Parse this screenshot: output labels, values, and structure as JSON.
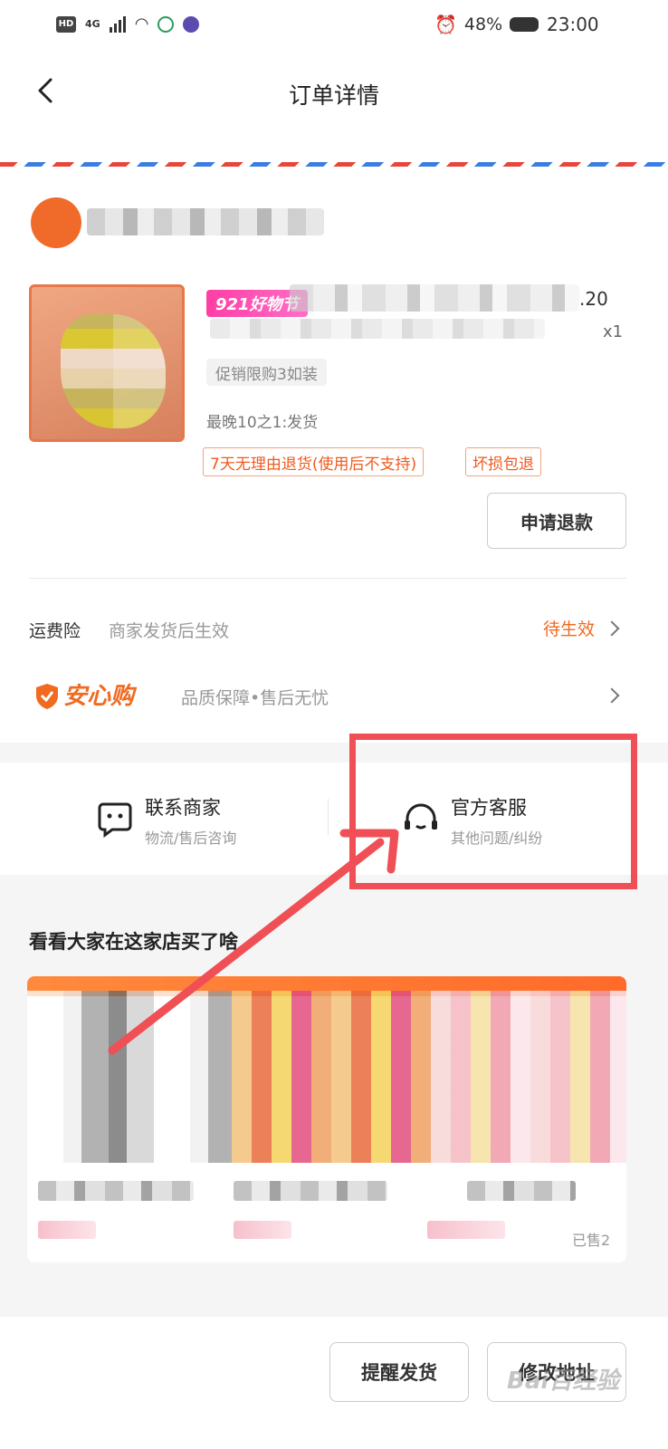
{
  "status_bar": {
    "hd": "HD",
    "network": "4G",
    "battery": "48%",
    "time": "23:00"
  },
  "header": {
    "title": "订单详情"
  },
  "product": {
    "promo_tag": "921好物节",
    "price_fragment": ".20",
    "quantity": "x1",
    "spec": "促销限购3如装",
    "shipping": "最晚10之1:发货",
    "tags": [
      "7天无理由退货(使用后不支持)",
      "坏损包退"
    ],
    "refund_button": "申请退款"
  },
  "insurance": {
    "label": "运费险",
    "description": "商家发货后生效",
    "status": "待生效"
  },
  "anxin": {
    "logo": "安心购",
    "description": "品质保障•售后无忧"
  },
  "contact": {
    "merchant": {
      "title": "联系商家",
      "subtitle": "物流/售后咨询"
    },
    "service": {
      "title": "官方客服",
      "subtitle": "其他问题/纠纷"
    }
  },
  "recommendations": {
    "title": "看看大家在这家店买了啥",
    "sold": "已售2"
  },
  "bottom": {
    "remind_button": "提醒发货",
    "modify_button": "修改地址"
  },
  "watermark": "Bai百经验",
  "colors": {
    "accent": "#f06a1f",
    "highlight_box": "#ef4f55",
    "arrow": "#ef4f55"
  }
}
